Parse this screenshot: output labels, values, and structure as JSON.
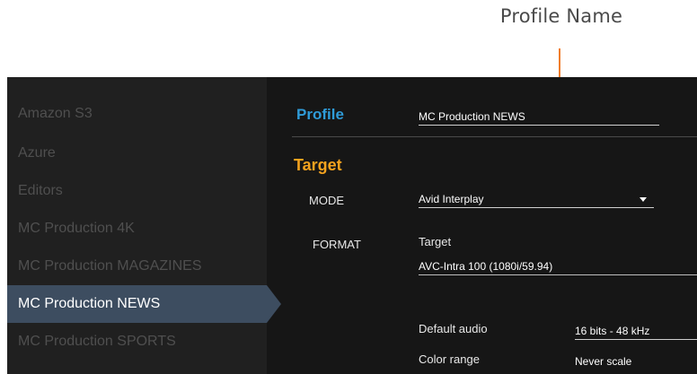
{
  "annotation": {
    "label": "Profile Name"
  },
  "sidebar": {
    "items": [
      {
        "label": "Amazon S3"
      },
      {
        "label": "Azure"
      },
      {
        "label": "Editors"
      },
      {
        "label": "MC Production 4K"
      },
      {
        "label": "MC Production MAGAZINES"
      },
      {
        "label": "MC Production NEWS"
      },
      {
        "label": "MC Production SPORTS"
      }
    ],
    "active_index": 5
  },
  "main": {
    "profile_heading": "Profile",
    "profile_name_value": "MC Production NEWS",
    "target_heading": "Target",
    "mode_label": "MODE",
    "mode_value": "Avid Interplay",
    "format_label": "FORMAT",
    "format_sub_label": "Target",
    "format_value": "AVC-Intra 100 (1080i/59.94)",
    "default_audio_label": "Default audio",
    "default_audio_value": "16 bits - 48 kHz",
    "color_range_label": "Color range",
    "color_range_value": "Never scale"
  },
  "colors": {
    "accent_blue": "#2f9bd8",
    "accent_orange": "#f3a21e",
    "annotation_orange": "#f07d2b",
    "active_item_bg": "#3d4d60"
  }
}
